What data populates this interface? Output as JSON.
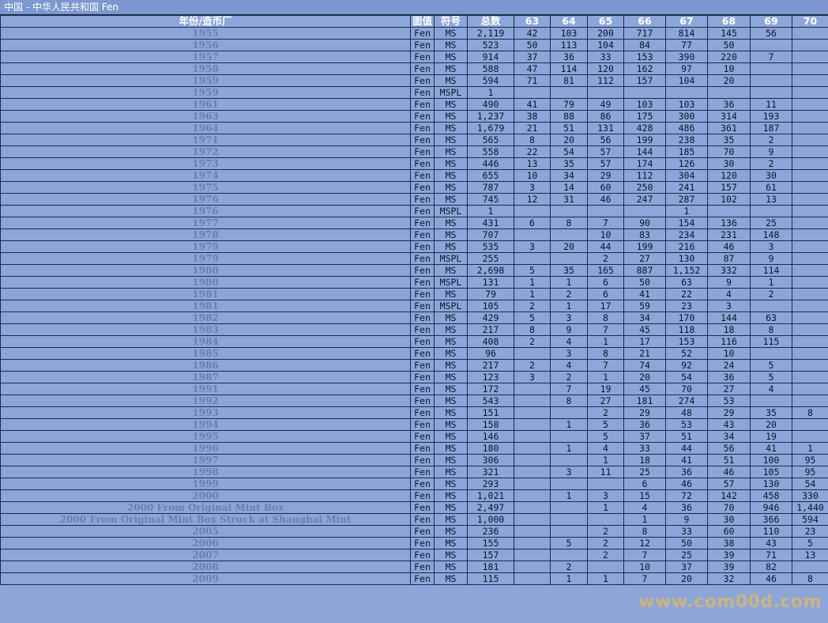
{
  "title": "中国 - 中华人民共和国 Fen",
  "headers": [
    "年份/造币厂",
    "面值",
    "符号",
    "总数",
    "63",
    "64",
    "65",
    "66",
    "67",
    "68",
    "69",
    "70"
  ],
  "watermark": "www.com00d.com",
  "rows": [
    [
      "1955",
      "Fen",
      "MS",
      "2,119",
      "42",
      "103",
      "200",
      "717",
      "814",
      "145",
      "56",
      ""
    ],
    [
      "1956",
      "Fen",
      "MS",
      "523",
      "50",
      "113",
      "104",
      "84",
      "77",
      "50",
      "",
      ""
    ],
    [
      "1957",
      "Fen",
      "MS",
      "914",
      "37",
      "36",
      "33",
      "153",
      "390",
      "220",
      "7",
      ""
    ],
    [
      "1958",
      "Fen",
      "MS",
      "588",
      "47",
      "114",
      "120",
      "162",
      "97",
      "10",
      "",
      ""
    ],
    [
      "1959",
      "Fen",
      "MS",
      "594",
      "71",
      "81",
      "112",
      "157",
      "104",
      "20",
      "",
      ""
    ],
    [
      "1959",
      "Fen",
      "MSPL",
      "1",
      "",
      "",
      "",
      "",
      "",
      "",
      "",
      ""
    ],
    [
      "1961",
      "Fen",
      "MS",
      "490",
      "41",
      "79",
      "49",
      "103",
      "103",
      "36",
      "11",
      ""
    ],
    [
      "1963",
      "Fen",
      "MS",
      "1,237",
      "38",
      "88",
      "86",
      "175",
      "300",
      "314",
      "193",
      ""
    ],
    [
      "1964",
      "Fen",
      "MS",
      "1,679",
      "21",
      "51",
      "131",
      "428",
      "486",
      "361",
      "187",
      ""
    ],
    [
      "1971",
      "Fen",
      "MS",
      "565",
      "8",
      "20",
      "56",
      "199",
      "238",
      "35",
      "2",
      ""
    ],
    [
      "1972",
      "Fen",
      "MS",
      "558",
      "22",
      "54",
      "57",
      "144",
      "185",
      "70",
      "9",
      ""
    ],
    [
      "1973",
      "Fen",
      "MS",
      "446",
      "13",
      "35",
      "57",
      "174",
      "126",
      "30",
      "2",
      ""
    ],
    [
      "1974",
      "Fen",
      "MS",
      "655",
      "10",
      "34",
      "29",
      "112",
      "304",
      "120",
      "30",
      ""
    ],
    [
      "1975",
      "Fen",
      "MS",
      "787",
      "3",
      "14",
      "60",
      "250",
      "241",
      "157",
      "61",
      ""
    ],
    [
      "1976",
      "Fen",
      "MS",
      "745",
      "12",
      "31",
      "46",
      "247",
      "287",
      "102",
      "13",
      ""
    ],
    [
      "1976",
      "Fen",
      "MSPL",
      "1",
      "",
      "",
      "",
      "",
      "1",
      "",
      "",
      ""
    ],
    [
      "1977",
      "Fen",
      "MS",
      "431",
      "6",
      "8",
      "7",
      "90",
      "154",
      "136",
      "25",
      ""
    ],
    [
      "1978",
      "Fen",
      "MS",
      "707",
      "",
      "",
      "10",
      "83",
      "234",
      "231",
      "148",
      ""
    ],
    [
      "1979",
      "Fen",
      "MS",
      "535",
      "3",
      "20",
      "44",
      "199",
      "216",
      "46",
      "3",
      ""
    ],
    [
      "1979",
      "Fen",
      "MSPL",
      "255",
      "",
      "",
      "2",
      "27",
      "130",
      "87",
      "9",
      ""
    ],
    [
      "1980",
      "Fen",
      "MS",
      "2,698",
      "5",
      "35",
      "165",
      "887",
      "1,152",
      "332",
      "114",
      ""
    ],
    [
      "1980",
      "Fen",
      "MSPL",
      "131",
      "1",
      "1",
      "6",
      "50",
      "63",
      "9",
      "1",
      ""
    ],
    [
      "1981",
      "Fen",
      "MS",
      "79",
      "1",
      "2",
      "6",
      "41",
      "22",
      "4",
      "2",
      ""
    ],
    [
      "1981",
      "Fen",
      "MSPL",
      "105",
      "2",
      "1",
      "17",
      "59",
      "23",
      "3",
      "",
      ""
    ],
    [
      "1982",
      "Fen",
      "MS",
      "429",
      "5",
      "3",
      "8",
      "34",
      "170",
      "144",
      "63",
      ""
    ],
    [
      "1983",
      "Fen",
      "MS",
      "217",
      "8",
      "9",
      "7",
      "45",
      "118",
      "18",
      "8",
      ""
    ],
    [
      "1984",
      "Fen",
      "MS",
      "408",
      "2",
      "4",
      "1",
      "17",
      "153",
      "116",
      "115",
      ""
    ],
    [
      "1985",
      "Fen",
      "MS",
      "96",
      "",
      "3",
      "8",
      "21",
      "52",
      "10",
      "",
      ""
    ],
    [
      "1986",
      "Fen",
      "MS",
      "217",
      "2",
      "4",
      "7",
      "74",
      "92",
      "24",
      "5",
      ""
    ],
    [
      "1987",
      "Fen",
      "MS",
      "123",
      "3",
      "2",
      "1",
      "20",
      "54",
      "36",
      "5",
      ""
    ],
    [
      "1991",
      "Fen",
      "MS",
      "172",
      "",
      "7",
      "19",
      "45",
      "70",
      "27",
      "4",
      ""
    ],
    [
      "1992",
      "Fen",
      "MS",
      "543",
      "",
      "8",
      "27",
      "181",
      "274",
      "53",
      "",
      ""
    ],
    [
      "1993",
      "Fen",
      "MS",
      "151",
      "",
      "",
      "2",
      "29",
      "48",
      "29",
      "35",
      "8"
    ],
    [
      "1994",
      "Fen",
      "MS",
      "158",
      "",
      "1",
      "5",
      "36",
      "53",
      "43",
      "20",
      ""
    ],
    [
      "1995",
      "Fen",
      "MS",
      "146",
      "",
      "",
      "5",
      "37",
      "51",
      "34",
      "19",
      ""
    ],
    [
      "1996",
      "Fen",
      "MS",
      "180",
      "",
      "1",
      "4",
      "33",
      "44",
      "56",
      "41",
      "1"
    ],
    [
      "1997",
      "Fen",
      "MS",
      "306",
      "",
      "",
      "1",
      "18",
      "41",
      "51",
      "100",
      "95"
    ],
    [
      "1998",
      "Fen",
      "MS",
      "321",
      "",
      "3",
      "11",
      "25",
      "36",
      "46",
      "105",
      "95"
    ],
    [
      "1999",
      "Fen",
      "MS",
      "293",
      "",
      "",
      "",
      "6",
      "46",
      "57",
      "130",
      "54"
    ],
    [
      "2000",
      "Fen",
      "MS",
      "1,021",
      "",
      "1",
      "3",
      "15",
      "72",
      "142",
      "458",
      "330"
    ],
    [
      "2000 From Original Mint Box",
      "Fen",
      "MS",
      "2,497",
      "",
      "",
      "1",
      "4",
      "36",
      "70",
      "946",
      "1,440"
    ],
    [
      "2000 From Original Mint Box Struck at Shanghai Mint",
      "Fen",
      "MS",
      "1,000",
      "",
      "",
      "",
      "1",
      "9",
      "30",
      "366",
      "594"
    ],
    [
      "2005",
      "Fen",
      "MS",
      "236",
      "",
      "",
      "2",
      "8",
      "33",
      "60",
      "110",
      "23"
    ],
    [
      "2006",
      "Fen",
      "MS",
      "155",
      "",
      "5",
      "2",
      "12",
      "50",
      "38",
      "43",
      "5"
    ],
    [
      "2007",
      "Fen",
      "MS",
      "157",
      "",
      "",
      "2",
      "7",
      "25",
      "39",
      "71",
      "13"
    ],
    [
      "2008",
      "Fen",
      "MS",
      "181",
      "",
      "2",
      "",
      "10",
      "37",
      "39",
      "82",
      ""
    ],
    [
      "2009",
      "Fen",
      "MS",
      "115",
      "",
      "1",
      "1",
      "7",
      "20",
      "32",
      "46",
      "8"
    ]
  ]
}
